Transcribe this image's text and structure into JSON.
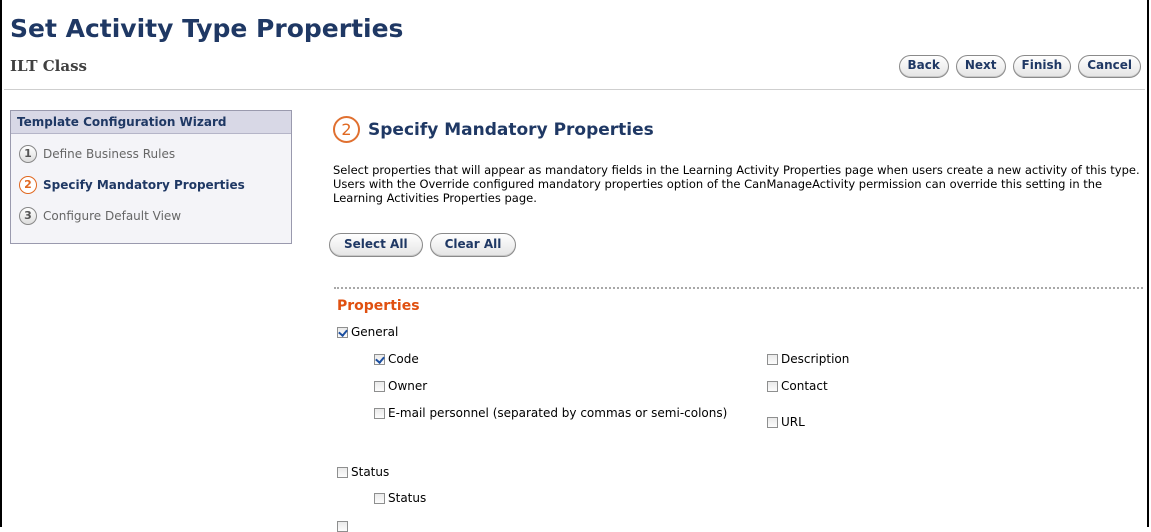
{
  "header": {
    "title": "Set Activity Type Properties",
    "subtitle": "ILT Class",
    "buttons": {
      "back": "Back",
      "next": "Next",
      "finish": "Finish",
      "cancel": "Cancel"
    }
  },
  "wizard": {
    "title": "Template Configuration Wizard",
    "steps": [
      {
        "num": "1",
        "label": "Define Business Rules",
        "active": false
      },
      {
        "num": "2",
        "label": "Specify Mandatory Properties",
        "active": true
      },
      {
        "num": "3",
        "label": "Configure Default View",
        "active": false
      }
    ]
  },
  "step": {
    "num": "2",
    "title": "Specify Mandatory Properties",
    "description": "Select properties that will appear as mandatory fields in the Learning Activity Properties page when users create a new activity of this type. Users with the Override configured mandatory properties option of the CanManageActivity permission can override this setting in the Learning Activities Properties page.",
    "select_all": "Select All",
    "clear_all": "Clear All"
  },
  "properties": {
    "section_title": "Properties",
    "general": {
      "label": "General",
      "checked": true
    },
    "code": {
      "label": "Code",
      "checked": true
    },
    "owner": {
      "label": "Owner",
      "checked": false
    },
    "email": {
      "label": "E-mail personnel (separated by commas or semi-colons)",
      "checked": false
    },
    "description": {
      "label": "Description",
      "checked": false
    },
    "contact": {
      "label": "Contact",
      "checked": false
    },
    "url": {
      "label": "URL",
      "checked": false
    },
    "status_group": {
      "label": "Status",
      "checked": false
    },
    "status": {
      "label": "Status",
      "checked": false
    }
  }
}
